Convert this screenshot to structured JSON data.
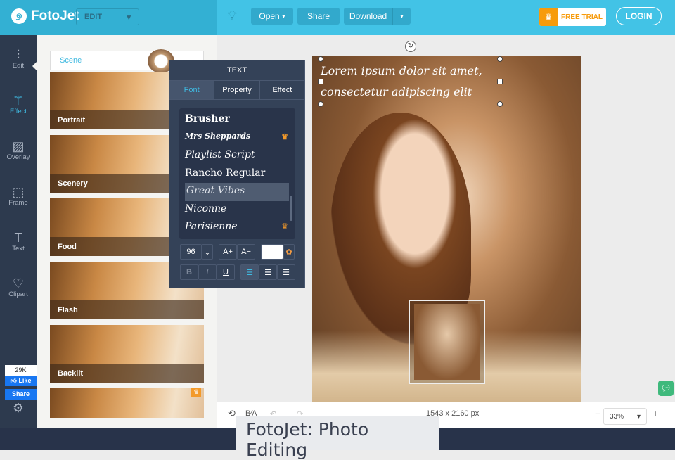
{
  "header": {
    "logo": "FotoJet",
    "mode": "EDIT",
    "open_label": "Open",
    "share_label": "Share",
    "download_label": "Download",
    "free_trial_label": "FREE TRIAL",
    "login_label": "LOGIN"
  },
  "sidebar": {
    "items": [
      {
        "label": "Edit",
        "icon": "sliders-icon"
      },
      {
        "label": "Effect",
        "icon": "magic-wand-icon"
      },
      {
        "label": "Overlay",
        "icon": "stripes-icon"
      },
      {
        "label": "Frame",
        "icon": "frame-icon"
      },
      {
        "label": "Text",
        "icon": "text-icon"
      },
      {
        "label": "Clipart",
        "icon": "heart-icon"
      }
    ],
    "facebook": {
      "count": "29K",
      "like_label": "Like",
      "share_label": "Share"
    }
  },
  "effects_panel": {
    "category": "Scene",
    "items": [
      "Portrait",
      "Scenery",
      "Food",
      "Flash",
      "Backlit"
    ]
  },
  "text_panel": {
    "title": "TEXT",
    "tabs": [
      "Font",
      "Property",
      "Effect"
    ],
    "fonts": [
      {
        "name": "Brusher",
        "premium": false
      },
      {
        "name": "Mrs Sheppards",
        "premium": true
      },
      {
        "name": "Playlist Script",
        "premium": false
      },
      {
        "name": "Rancho Regular",
        "premium": false
      },
      {
        "name": "Great Vibes",
        "premium": false
      },
      {
        "name": "Niconne",
        "premium": false
      },
      {
        "name": "Parisienne",
        "premium": true
      }
    ],
    "selected_font": "Great Vibes",
    "font_size": "96",
    "increase_label": "A+",
    "decrease_label": "A−",
    "text_color": "#ffffff",
    "bold_label": "B",
    "italic_label": "I",
    "underline_label": "U",
    "alignment": "left"
  },
  "canvas": {
    "text_line1": "Lorem ipsum dolor sit amet,",
    "text_line2": "consectetur adipiscing elit"
  },
  "bottom_bar": {
    "dimensions": "1543 x 2160 px",
    "zoom": "33%",
    "zoom_out": "−",
    "zoom_in": "+"
  },
  "caption": "FotoJet: Photo Editing",
  "colors": {
    "accent": "#3fb9e0",
    "header": "#42c3e6",
    "sidebar": "#2d3a4e",
    "premium": "#f79b0c"
  }
}
